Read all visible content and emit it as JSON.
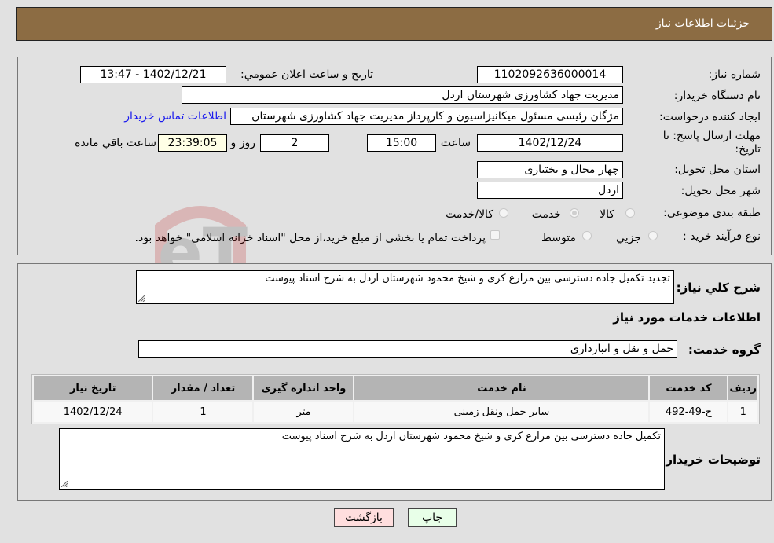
{
  "header": {
    "title": "جزئیات اطلاعات نیاز"
  },
  "info": {
    "need_number_label": "شماره نیاز:",
    "need_number": "1102092636000014",
    "announce_label": "تاریخ و ساعت اعلان عمومي:",
    "announce_value": "1402/12/21 - 13:47",
    "buyer_org_label": "نام دستگاه خریدار:",
    "buyer_org": "مدیریت جهاد کشاورزی شهرستان اردل",
    "creator_label": "ایجاد کننده درخواست:",
    "creator": "مژگان رئیسی مسئول میکانیزاسیون و کارپرداز مدیریت جهاد کشاورزی شهرستان",
    "contact_link": "اطلاعات تماس خریدار",
    "deadline_label_line1": "مهلت ارسال پاسخ: تا",
    "deadline_label_line2": "تاریخ:",
    "deadline_date": "1402/12/24",
    "time_label": "ساعت",
    "deadline_time": "15:00",
    "days_value": "2",
    "days_label": "روز و",
    "remaining_time": "23:39:05",
    "remaining_label": "ساعت باقي مانده",
    "province_label": "استان محل تحویل:",
    "province": "چهار محال و بختیاری",
    "city_label": "شهر محل تحویل:",
    "city": "اردل",
    "category_label": "طبقه بندی موضوعی:",
    "category_options": [
      {
        "label": "کالا",
        "selected": false
      },
      {
        "label": "خدمت",
        "selected": true
      },
      {
        "label": "کالا/خدمت",
        "selected": false
      }
    ],
    "process_label": "نوع فرآیند خرید :",
    "process_options": [
      {
        "label": "جزيي",
        "selected": false
      },
      {
        "label": "متوسط",
        "selected": false
      }
    ],
    "treasury_checkbox_label": "پرداخت تمام یا بخشی از مبلغ خرید،از محل \"اسناد خزانه اسلامی\" خواهد بود."
  },
  "details": {
    "description_label": "شرح کلي نیاز:",
    "description": "تجدید تکمیل جاده دسترسی بین مزارع کری و شیخ محمود  شهرستان اردل به شرح اسناد پیوست",
    "services_heading": "اطلاعات خدمات مورد نیاز",
    "service_group_label": "گروه خدمت:",
    "service_group": "حمل و نقل و انبارداری",
    "table": {
      "columns": [
        "ردیف",
        "کد خدمت",
        "نام خدمت",
        "واحد اندازه گیری",
        "تعداد / مقدار",
        "تاریخ نیاز"
      ],
      "rows": [
        [
          "1",
          "ح-49-492",
          "سایر حمل ونقل زمینی",
          "متر",
          "1",
          "1402/12/24"
        ]
      ]
    },
    "buyer_notes_label": "توضیحات خریدار:",
    "buyer_notes": "تکمیل جاده دسترسی بین مزارع کری و شیخ محمود  شهرستان اردل به شرح اسناد پیوست"
  },
  "buttons": {
    "print": "چاپ",
    "back": "بازگشت"
  },
  "watermark": {
    "text": "AriaTender.neT"
  }
}
